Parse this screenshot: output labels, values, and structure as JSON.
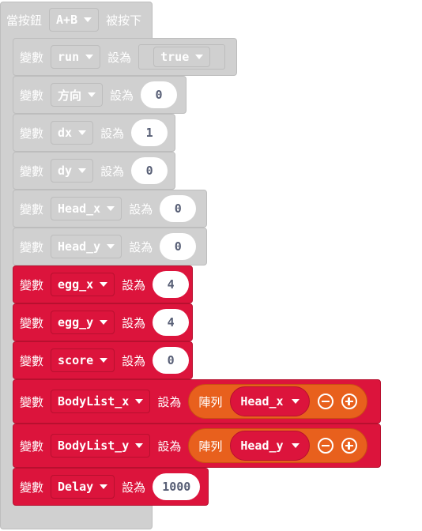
{
  "event": {
    "prefix": "當按鈕",
    "button": "A+B",
    "suffix": "被按下"
  },
  "set_label": "變數",
  "to_label": "設為",
  "array_label": "陣列",
  "rows": [
    {
      "var": "run",
      "value": "true"
    },
    {
      "var": "方向",
      "value": "0"
    },
    {
      "var": "dx",
      "value": "1"
    },
    {
      "var": "dy",
      "value": "0"
    },
    {
      "var": "Head_x",
      "value": "0"
    },
    {
      "var": "Head_y",
      "value": "0"
    },
    {
      "var": "egg_x",
      "value": "4"
    },
    {
      "var": "egg_y",
      "value": "4"
    },
    {
      "var": "score",
      "value": "0"
    },
    {
      "var": "BodyList_x",
      "value": "Head_x"
    },
    {
      "var": "BodyList_y",
      "value": "Head_y"
    },
    {
      "var": "Delay",
      "value": "1000"
    }
  ],
  "colors": {
    "disabled": "#d0d0d0",
    "variables": "#dc143c",
    "arrays": "#e8601d"
  }
}
